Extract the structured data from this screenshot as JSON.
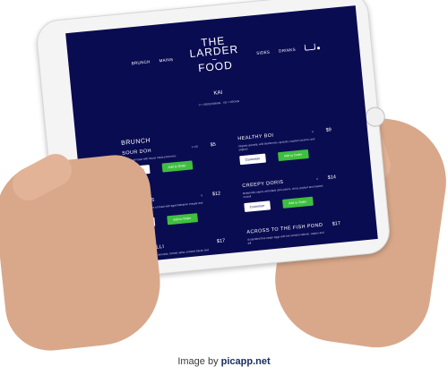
{
  "screen": {
    "nav_left": [
      "BRUNCH",
      "MAINS"
    ],
    "nav_right": [
      "SIDES",
      "DRINKS"
    ],
    "logo_lines": [
      "THE",
      "LARDER",
      "~",
      "FOOD"
    ],
    "kai": "KAI",
    "legend": "V = VEGETARIAN · VG = VEGAN",
    "section": "BRUNCH",
    "items": [
      {
        "name": "SOUR DOH",
        "tag": "V VG",
        "price": "$5",
        "desc": "Sourdough toast with house made preserves",
        "customize": "Customize",
        "add": "Add to Order"
      },
      {
        "name": "HEALTHY BOI",
        "tag": "V",
        "price": "$9",
        "desc": "Organic granola, wild blueberries, apricots, toasted coconut, and yoghurt",
        "customize": "Customize",
        "add": "Add to Order"
      },
      {
        "name": "SHROOMS",
        "tag": "V",
        "price": "$12",
        "desc": "Portobello mushrooms on toast with aged balsamic vinegar and parmesan",
        "customize": "Customize",
        "add": "Add to Order"
      },
      {
        "name": "CREEPY DORIS",
        "tag": "V",
        "price": "$14",
        "desc": "Buttermilk crepes with black doris plums, citrus yoghurt and toasted muesli",
        "customize": "Customize",
        "add": "Add to Order"
      },
      {
        "name": "A BIT CHILLI",
        "tag": "",
        "price": "$17",
        "desc": "Breakfast fritters with avocado, tomato salsa, smoked bacon and fresh chilli",
        "customize": "",
        "add": ""
      },
      {
        "name": "ACROSS TO THE FISH POND",
        "tag": "",
        "price": "$17",
        "desc": "Scrambled free range eggs with hot smoked salmon, capers and dill",
        "customize": "",
        "add": ""
      }
    ]
  },
  "watermark": {
    "prefix": "Image by",
    "brand": "picapp.net"
  },
  "colors": {
    "screen_bg": "#0a0c52",
    "add_button": "#3fbf3f",
    "tablet_frame": "#f4f4f4"
  }
}
